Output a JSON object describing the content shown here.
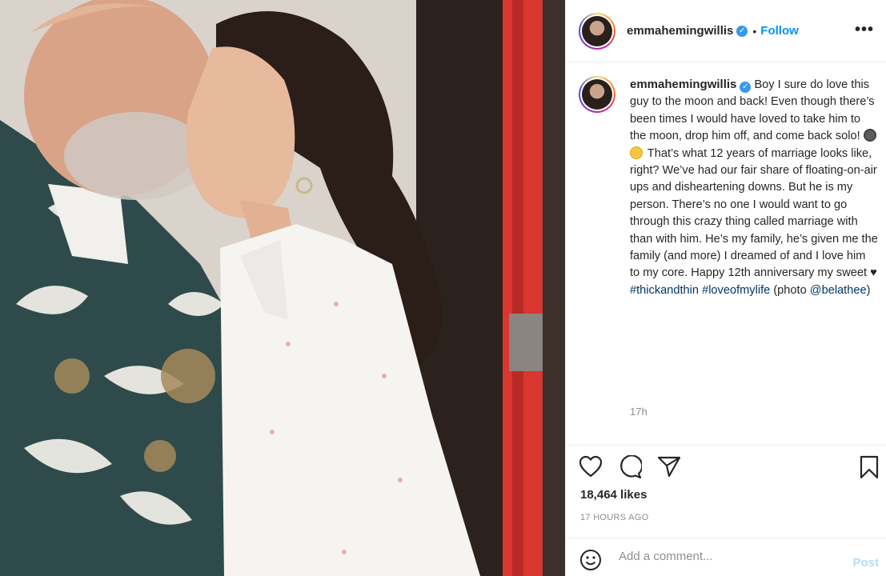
{
  "header": {
    "username": "emmahemingwillis",
    "verified_icon": "verified-badge-icon",
    "separator": "•",
    "follow_label": "Follow",
    "more_label": "•••"
  },
  "caption": {
    "username": "emmahemingwillis",
    "text_part1": "Boy I sure do love this guy to the moon and back! Even though there’s been times I would have loved to take him to the moon, drop him off, and come back solo!",
    "text_part2": "That’s what 12 years of marriage looks like, right? We’ve had our fair share of floating-on-air ups and disheartening downs. But he is my person. There’s no one I would want to go through this crazy thing called marriage with than with him. He’s my family, he’s given me the family (and more) I dreamed of and I love him to my core. Happy 12th anniversary my sweet ♥",
    "hashtag1": "#thickandthin",
    "hashtag2": "#loveofmylife",
    "photo_credit_open": "(photo",
    "mention": "@belathee",
    "photo_credit_close": ")",
    "time": "17h"
  },
  "actions": {
    "icons": [
      "heart-icon",
      "comment-icon",
      "share-icon",
      "bookmark-icon"
    ]
  },
  "likes": "18,464 likes",
  "posted_ago": "17 HOURS AGO",
  "comment": {
    "placeholder": "Add a comment...",
    "post_label": "Post"
  }
}
